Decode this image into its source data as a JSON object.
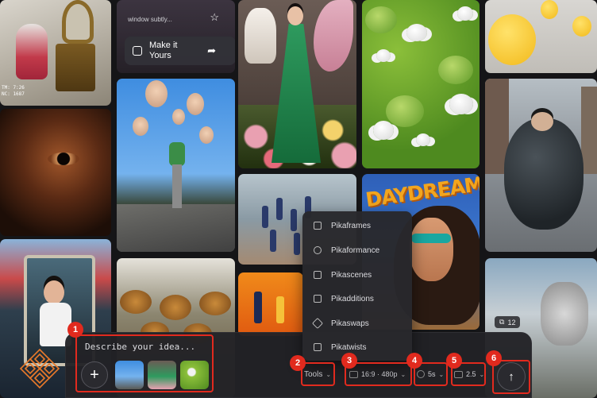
{
  "gallery": {
    "make_it_yours": {
      "caption": "window subtly...",
      "label": "Make it Yours"
    },
    "daydream_text": "DAYDREAM",
    "cat_meta": "TM: 7:26\nNC: 1687",
    "horse_badge_count": "12"
  },
  "composer": {
    "placeholder": "Describe your idea...",
    "add_label": "+",
    "tools_label": "Tools",
    "resolution_label": "16:9 · 480p",
    "duration_label": "5s",
    "credits_label": "2.5",
    "send_icon": "arrow-up-icon"
  },
  "tools_menu": {
    "items": [
      {
        "label": "Pikaframes",
        "icon": "frames-icon"
      },
      {
        "label": "Pikaformance",
        "icon": "performance-icon"
      },
      {
        "label": "Pikascenes",
        "icon": "scenes-icon"
      },
      {
        "label": "Pikadditions",
        "icon": "additions-icon"
      },
      {
        "label": "Pikaswaps",
        "icon": "swaps-icon"
      },
      {
        "label": "Pikatwists",
        "icon": "twists-icon"
      }
    ]
  },
  "annotations": {
    "n1": "1",
    "n2": "2",
    "n3": "3",
    "n4": "4",
    "n5": "5",
    "n6": "6"
  },
  "colors": {
    "annotation": "#e12a1e",
    "logo": "#e8792a",
    "background": "#151517"
  }
}
